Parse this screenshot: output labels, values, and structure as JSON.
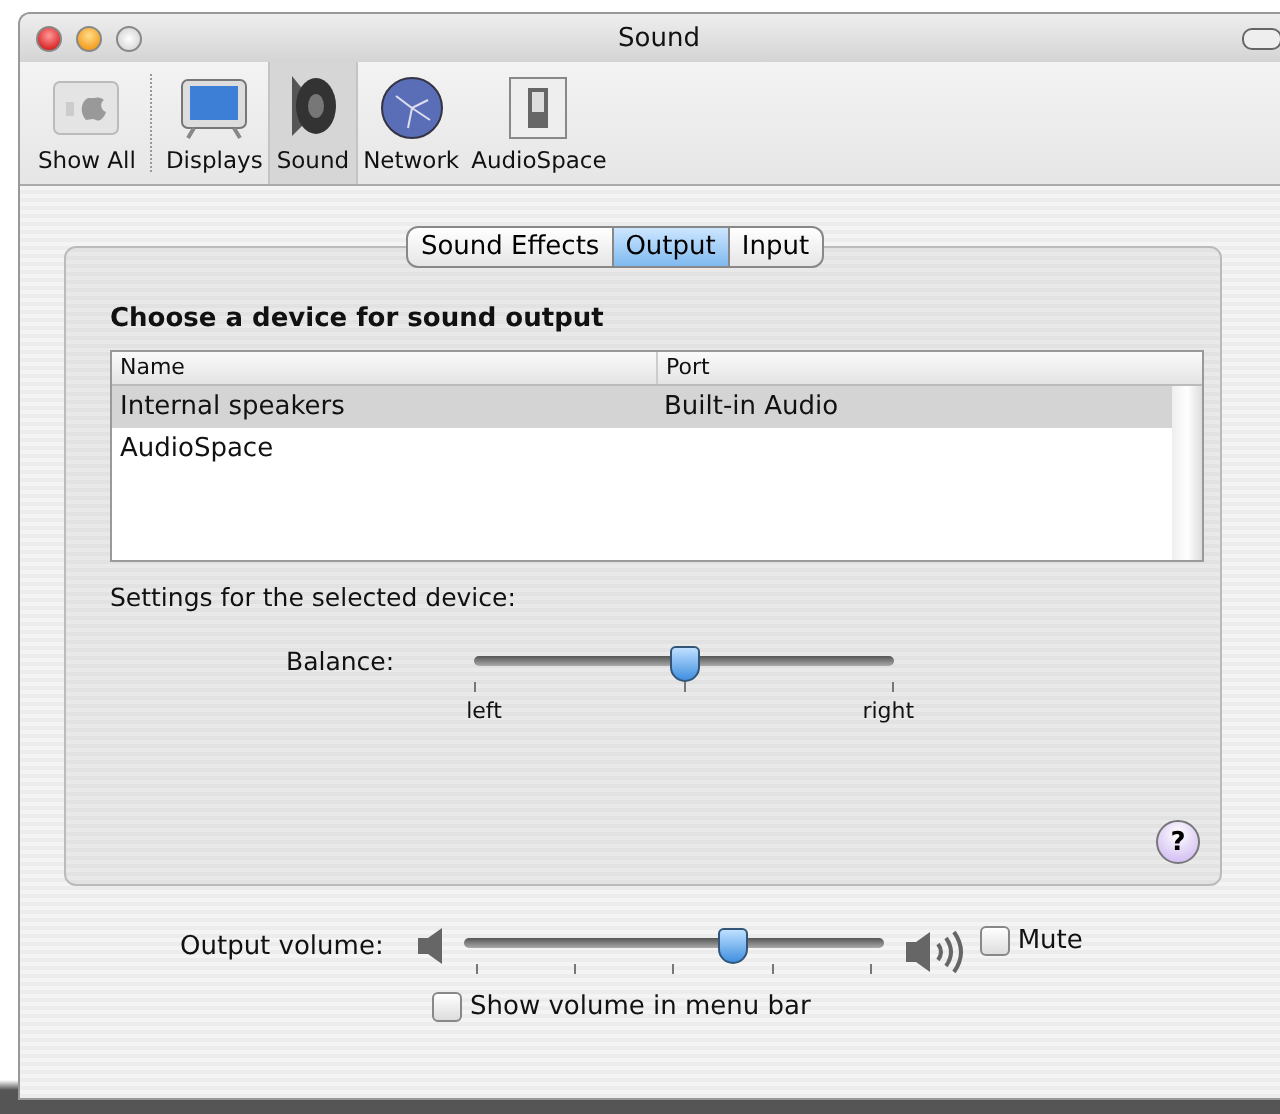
{
  "window": {
    "title": "Sound"
  },
  "toolbar": [
    {
      "label": "Show All",
      "kind": "showall",
      "selected": false
    },
    {
      "label": "Displays",
      "kind": "display",
      "selected": false
    },
    {
      "label": "Sound",
      "kind": "speaker",
      "selected": true
    },
    {
      "label": "Network",
      "kind": "globe",
      "selected": false
    },
    {
      "label": "AudioSpace",
      "kind": "switch",
      "selected": false
    }
  ],
  "tabs": [
    {
      "label": "Sound Effects",
      "selected": false
    },
    {
      "label": "Output",
      "selected": true
    },
    {
      "label": "Input",
      "selected": false
    }
  ],
  "heading": "Choose a device for sound output",
  "table": {
    "columns": [
      "Name",
      "Port"
    ],
    "rows": [
      {
        "cells": [
          "Internal speakers",
          "Built-in Audio"
        ],
        "selected": true
      },
      {
        "cells": [
          "AudioSpace"
        ],
        "selected": false
      }
    ]
  },
  "settings_label": "Settings for the selected device:",
  "balance": {
    "label": "Balance:",
    "level": 0.5,
    "min_label": "left",
    "max_label": "right"
  },
  "output_volume": {
    "label": "Output volume:",
    "level": 0.64
  },
  "mute": {
    "label": "Mute",
    "checked": false
  },
  "show_in_menu_bar": {
    "label": "Show volume in menu bar",
    "checked": false
  },
  "help": "?"
}
